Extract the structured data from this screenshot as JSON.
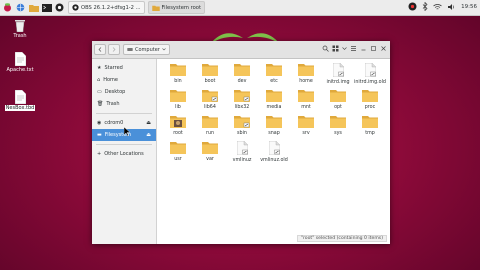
{
  "taskbar": {
    "tasks": [
      {
        "label": "OBS 26.1.2+dfsg1-2 ...",
        "icon": "obs-icon"
      },
      {
        "label": "Filesystem root",
        "icon": "folder-icon"
      }
    ],
    "clock": "19:56"
  },
  "desktop": [
    {
      "label": "Trash",
      "icon": "trash-icon"
    },
    {
      "label": "Apache.txt",
      "icon": "text-file-icon"
    },
    {
      "label": "NesBox.tbd",
      "icon": "text-file-icon"
    }
  ],
  "window": {
    "path_label": "Computer",
    "sidebar": {
      "places": [
        "Starred",
        "Home",
        "Desktop",
        "Trash"
      ],
      "devices": [
        "cdrom0",
        "Filesystem"
      ],
      "other": "Other Locations"
    },
    "files": [
      {
        "name": "bin",
        "type": "folder"
      },
      {
        "name": "boot",
        "type": "folder"
      },
      {
        "name": "dev",
        "type": "folder"
      },
      {
        "name": "etc",
        "type": "folder"
      },
      {
        "name": "home",
        "type": "folder"
      },
      {
        "name": "initrd.img",
        "type": "link-file"
      },
      {
        "name": "initrd.img.old",
        "type": "link-file"
      },
      {
        "name": "lib",
        "type": "folder"
      },
      {
        "name": "lib64",
        "type": "link-folder"
      },
      {
        "name": "libx32",
        "type": "link-folder"
      },
      {
        "name": "media",
        "type": "folder"
      },
      {
        "name": "mnt",
        "type": "folder"
      },
      {
        "name": "opt",
        "type": "folder"
      },
      {
        "name": "proc",
        "type": "folder"
      },
      {
        "name": "root",
        "type": "root-folder"
      },
      {
        "name": "run",
        "type": "folder"
      },
      {
        "name": "sbin",
        "type": "link-folder"
      },
      {
        "name": "snap",
        "type": "folder"
      },
      {
        "name": "srv",
        "type": "folder"
      },
      {
        "name": "sys",
        "type": "folder"
      },
      {
        "name": "tmp",
        "type": "folder"
      },
      {
        "name": "usr",
        "type": "folder"
      },
      {
        "name": "var",
        "type": "folder"
      },
      {
        "name": "vmlinuz",
        "type": "link-file"
      },
      {
        "name": "vmlinuz.old",
        "type": "link-file"
      }
    ],
    "status": "\"root\" selected (containing 0 items)"
  },
  "colors": {
    "folder": "#f5c55a",
    "folder_dark": "#e0a93c",
    "selection": "#4a90d9"
  }
}
